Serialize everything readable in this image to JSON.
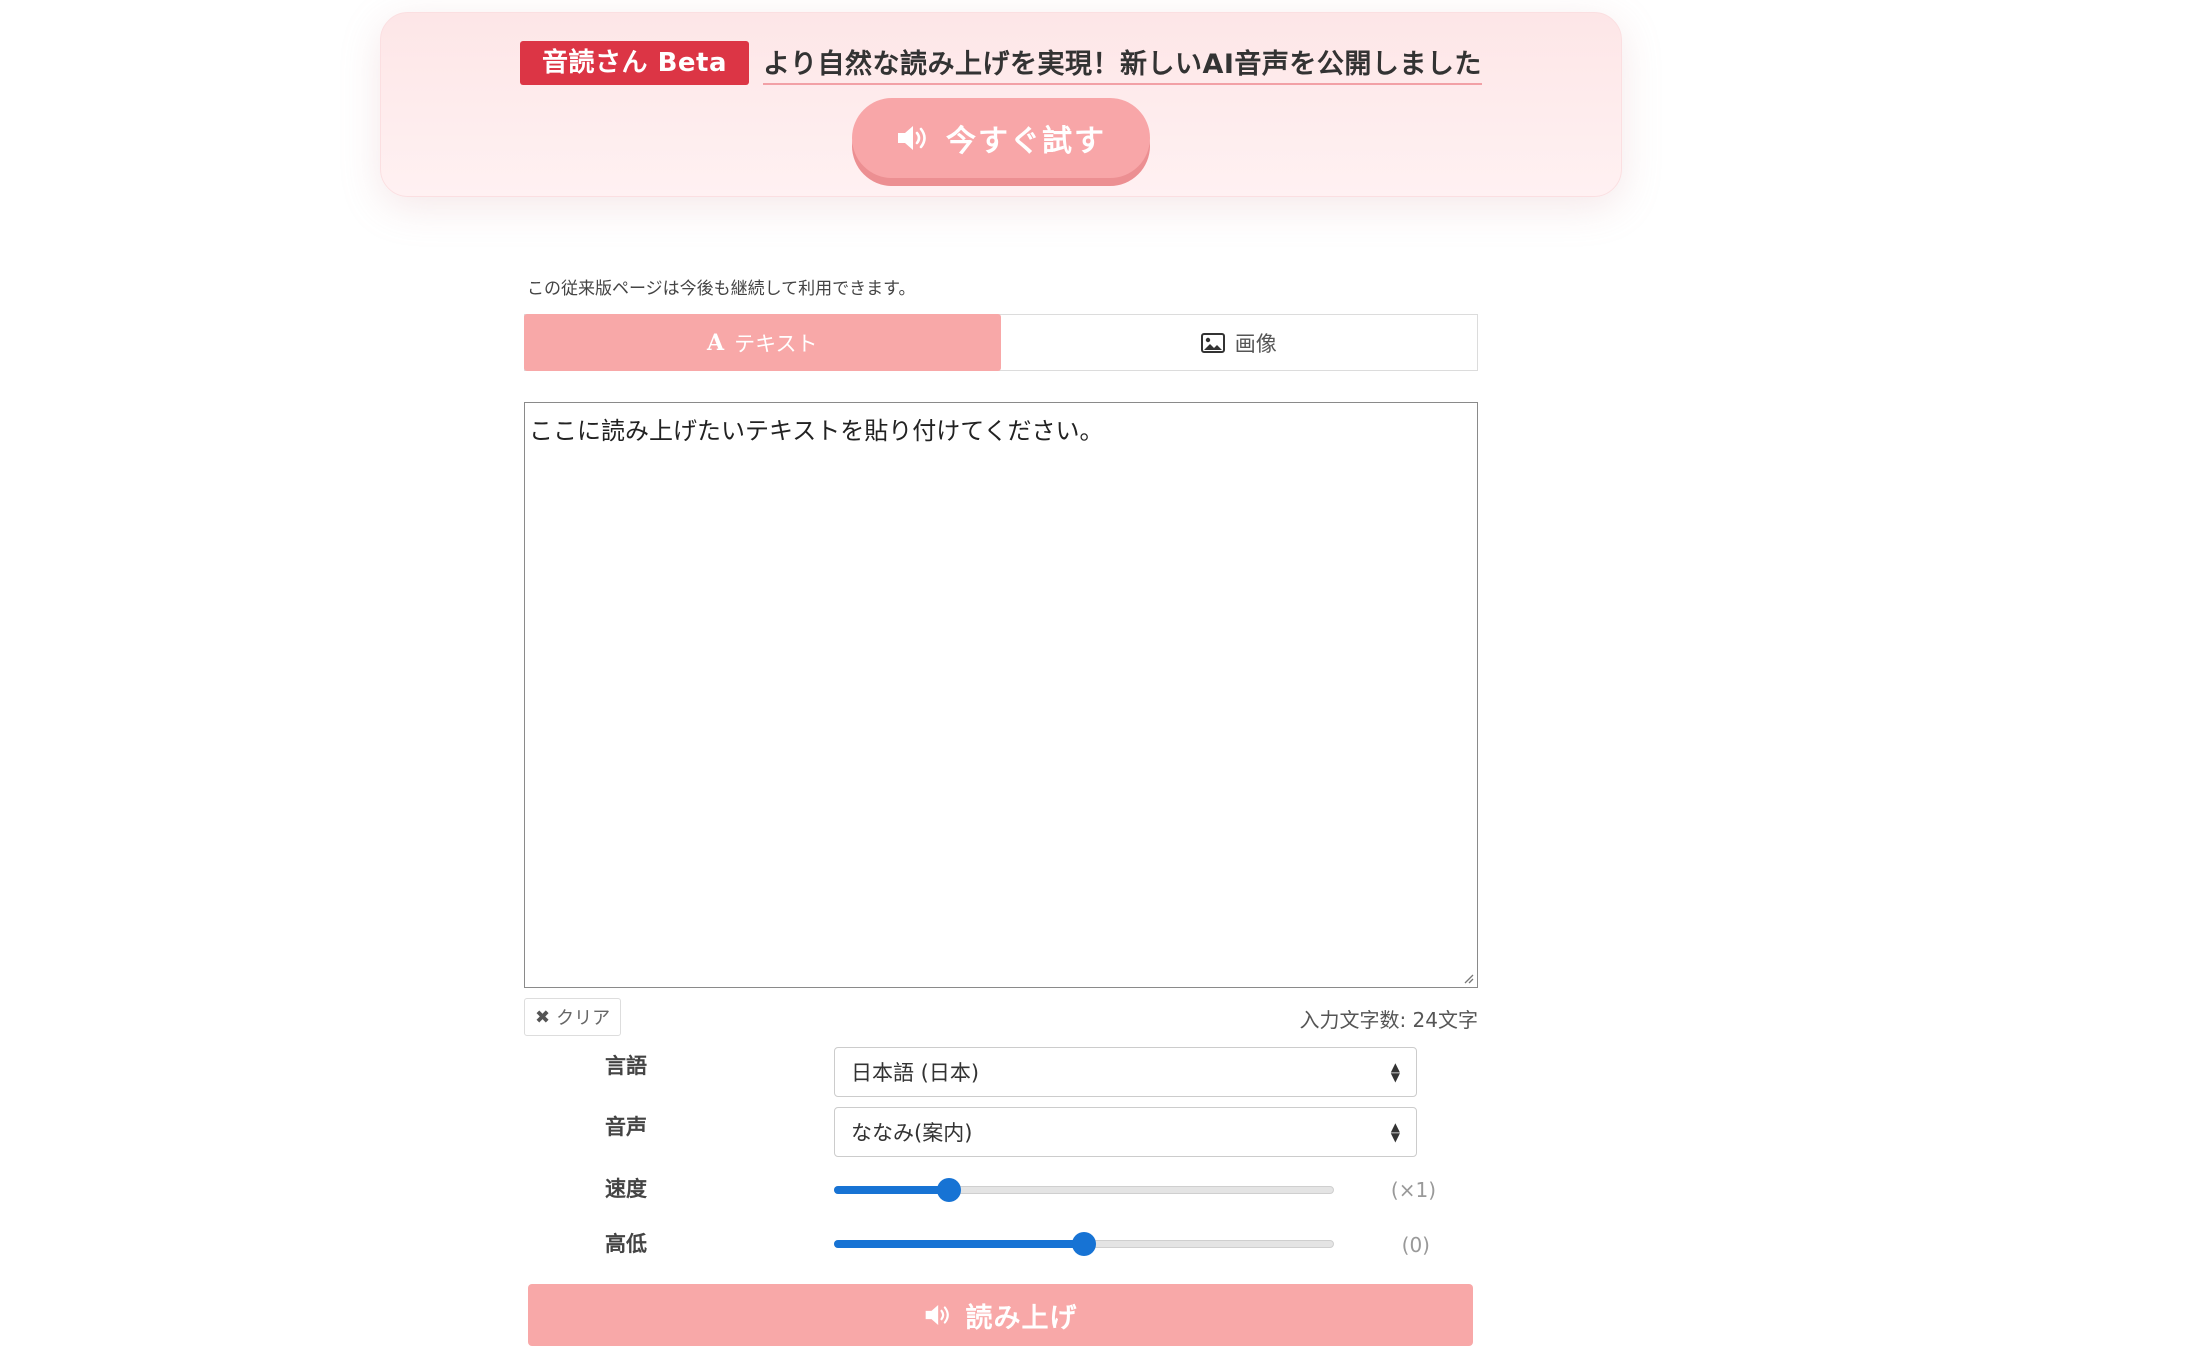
{
  "banner": {
    "badge": "音読さん Beta",
    "headline": "より自然な読み上げを実現！新しいAI音声を公開しました",
    "try_button_label": "今すぐ試す"
  },
  "main": {
    "note": "この従来版ページは今後も継続して利用できます。",
    "tabs": [
      {
        "label": "テキスト",
        "icon": "font-a-icon",
        "active": true
      },
      {
        "label": "画像",
        "icon": "image-icon",
        "active": false
      }
    ],
    "textarea": {
      "value": "ここに読み上げたいテキストを貼り付けてください。"
    },
    "clear_button_label": "クリア",
    "char_count": "入力文字数: 24文字"
  },
  "settings": {
    "language": {
      "label": "言語",
      "value": "日本語 (日本)"
    },
    "voice": {
      "label": "音声",
      "value": "ななみ(案内)"
    },
    "speed": {
      "label": "速度",
      "value_text": "(×1)",
      "level": 0.23
    },
    "pitch": {
      "label": "高低",
      "value_text": "(0)",
      "level": 0.5
    }
  },
  "read_button_label": "読み上げ",
  "colors": {
    "accent_pink": "#f8a8a8",
    "badge_red": "#dc3545",
    "slider_blue": "#1773d4"
  }
}
